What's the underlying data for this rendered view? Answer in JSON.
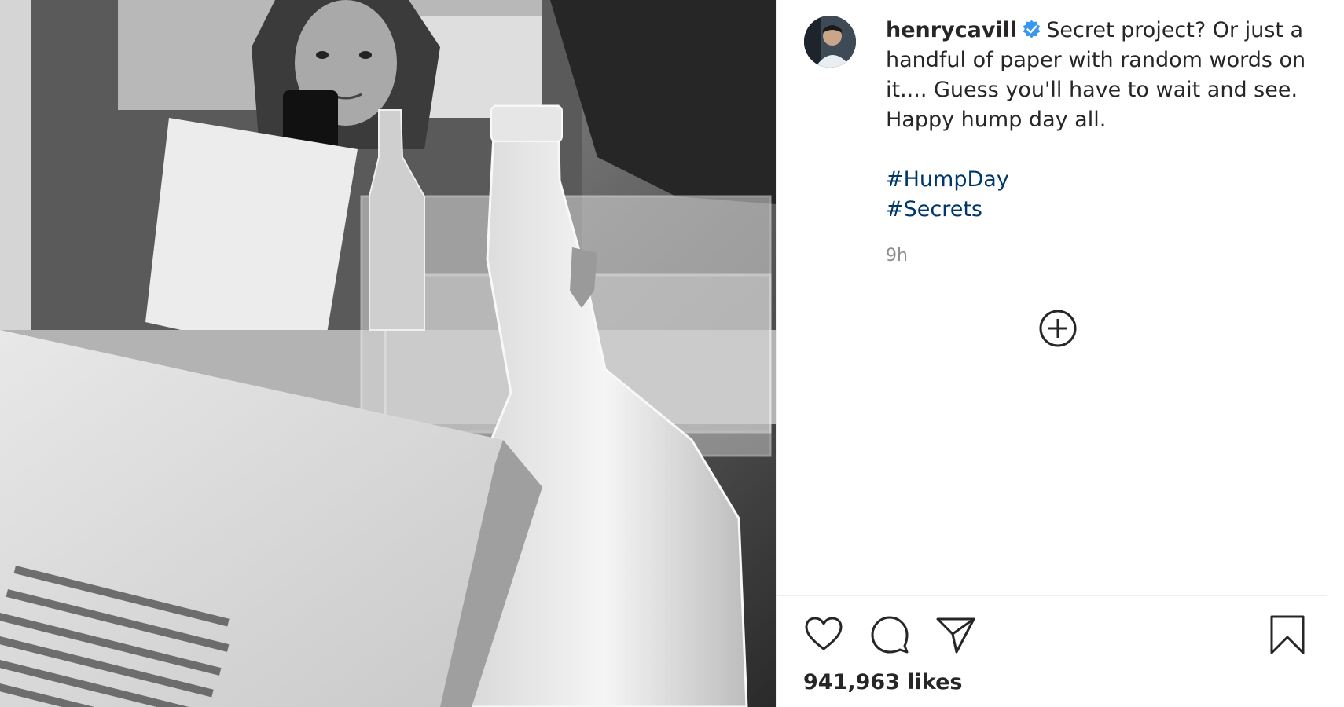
{
  "post": {
    "username": "henrycavill",
    "verified": true,
    "caption": "Secret project? Or just a handful of paper with random words on it.... Guess you'll have to wait and see. Happy hump day all.",
    "hashtags": [
      "#HumpDay",
      "#Secrets"
    ],
    "time": "9h",
    "likes": "941,963 likes"
  },
  "icons": {
    "verified": "verified-badge-icon",
    "load_more": "plus-circle-icon",
    "like": "heart-icon",
    "comment": "comment-icon",
    "share": "paper-plane-icon",
    "save": "bookmark-icon"
  },
  "colors": {
    "text": "#262626",
    "hashtag": "#00376b",
    "muted": "#8e8e8e",
    "verified": "#3897f0"
  }
}
